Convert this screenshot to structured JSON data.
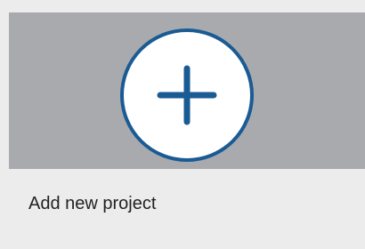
{
  "card": {
    "label": "Add new project",
    "icon": "plus-icon",
    "colors": {
      "thumbnail_background": "#a9aaae",
      "accent": "#1a5b94",
      "circle_fill": "#ffffff",
      "card_background": "#ececec",
      "text": "#222222"
    }
  }
}
